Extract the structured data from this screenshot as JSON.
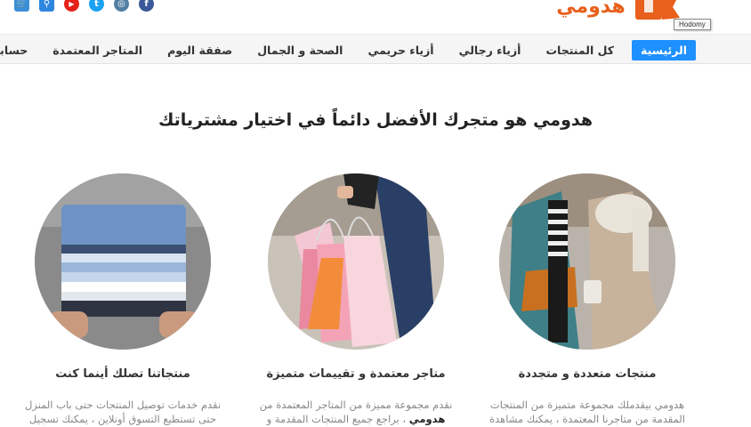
{
  "social": [
    {
      "name": "cart",
      "glyph": "🛒",
      "color": "#3b8fd6"
    },
    {
      "name": "search",
      "glyph": "⚲",
      "color": "#2e86de"
    },
    {
      "name": "youtube",
      "glyph": "▶",
      "color": "#e62117"
    },
    {
      "name": "twitter",
      "glyph": "t",
      "color": "#1da1f2"
    },
    {
      "name": "instagram",
      "glyph": "◎",
      "color": "#517fa4"
    },
    {
      "name": "facebook",
      "glyph": "f",
      "color": "#3b5998"
    }
  ],
  "brand": {
    "logo_text": "هدومي",
    "tooltip": "Hodomy",
    "color": "#e8601c"
  },
  "nav": [
    {
      "label": "الرئيسية",
      "active": true
    },
    {
      "label": "كل المنتجات"
    },
    {
      "label": "أزياء رجالي"
    },
    {
      "label": "أزياء حريمي"
    },
    {
      "label": "الصحة و الجمال"
    },
    {
      "label": "صفقة اليوم"
    },
    {
      "label": "المتاجر المعتمدة"
    },
    {
      "label": "حسابي"
    }
  ],
  "accent_color": "#1e90ff",
  "headline": "هدومي هو متجرك الأفضل دائماً في اختيار مشترياتك",
  "features": [
    {
      "title": "منتجات متعددة و متجددة",
      "line1": "هدومي بيقدملك مجموعة متميزة من المنتجات",
      "line2": "المقدمة من متاجرنا المعتمدة ، يمكنك مشاهدة"
    },
    {
      "title": "متاجر معتمدة و تقييمات متميزة",
      "line1": "نقدم مجموعة مميزة من المتاجر المعتمدة من",
      "line2_strong": "هدومي",
      "line2_rest": " ، براجع جميع المنتجات المقدمة و"
    },
    {
      "title": "منتجاتنا تصلك أينما كنت",
      "line1": "نقدم خدمات توصيل المنتجات حتى باب المنزل",
      "line2": "حتى تستطيع التسوق أونلاين ، يمكنك تسجيل"
    }
  ]
}
